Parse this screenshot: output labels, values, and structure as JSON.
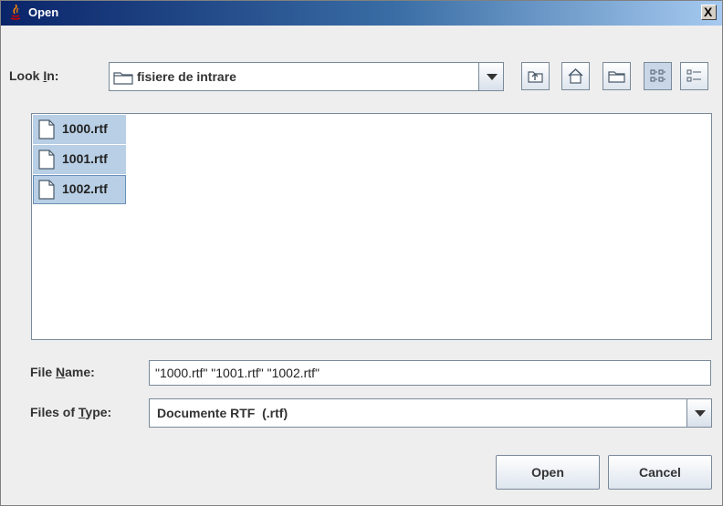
{
  "window": {
    "title": "Open",
    "close_label": "X"
  },
  "look_in": {
    "label_prefix": "Look ",
    "label_mnemonic": "I",
    "label_suffix": "n:",
    "selected": "fisiere de intrare"
  },
  "toolbar": {
    "buttons": [
      {
        "icon": "up-one-level-icon"
      },
      {
        "icon": "home-icon"
      },
      {
        "icon": "new-folder-icon"
      },
      {
        "icon": "list-view-icon",
        "pressed": true
      },
      {
        "icon": "details-view-icon"
      }
    ]
  },
  "files": [
    {
      "name": "1000.rtf",
      "selected": true
    },
    {
      "name": "1001.rtf",
      "selected": true
    },
    {
      "name": "1002.rtf",
      "selected": true,
      "focused": true
    }
  ],
  "file_name": {
    "label_prefix": "File ",
    "label_mnemonic": "N",
    "label_suffix": "ame:",
    "value": "\"1000.rtf\" \"1001.rtf\" \"1002.rtf\""
  },
  "files_of_type": {
    "label_prefix": "Files of ",
    "label_mnemonic": "T",
    "label_suffix": "ype:",
    "selected": "Documente RTF  (.rtf)"
  },
  "buttons": {
    "open": "Open",
    "cancel": "Cancel"
  }
}
